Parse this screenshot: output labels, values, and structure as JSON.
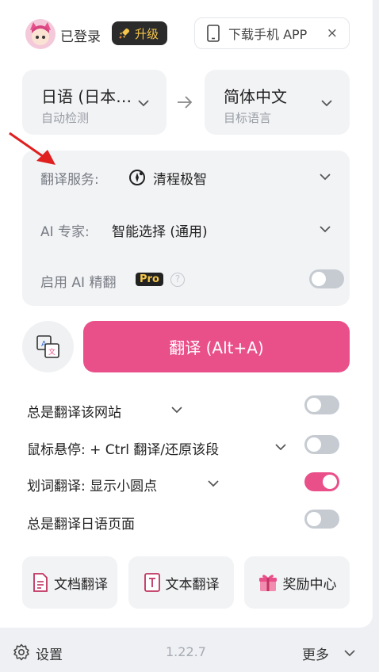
{
  "header": {
    "login_status": "已登录",
    "upgrade_label": "升级",
    "download_label": "下载手机 APP",
    "close_label": "×"
  },
  "languages": {
    "source": {
      "name": "日语 (日本…",
      "sub": "自动检测"
    },
    "target": {
      "name": "简体中文",
      "sub": "目标语言"
    }
  },
  "settings": {
    "service_label": "翻译服务:",
    "service_value": "清程极智",
    "expert_label": "AI 专家:",
    "expert_value": "智能选择 (通用)",
    "refine_label": "启用 AI 精翻",
    "pro_badge": "Pro",
    "help": "?",
    "refine_enabled": false
  },
  "translate_button": "翻译 (Alt+A)",
  "options": [
    {
      "label": "总是翻译该网站",
      "enabled": false
    },
    {
      "label": "鼠标悬停:  + Ctrl 翻译/还原该段",
      "enabled": false
    },
    {
      "label": "划词翻译:  显示小圆点",
      "enabled": true
    },
    {
      "label": "总是翻译日语页面",
      "enabled": false
    }
  ],
  "tools": {
    "doc_translate": "文档翻译",
    "text_translate": "文本翻译",
    "rewards": "奖励中心"
  },
  "footer": {
    "settings_label": "设置",
    "version": "1.22.7",
    "more_label": "更多"
  },
  "colors": {
    "accent": "#e9508a",
    "card_bg": "#f2f3f5",
    "toggle_off": "#c6cbd2",
    "annotation_arrow": "#e01f1f"
  },
  "icons": [
    "avatar",
    "rocket-icon",
    "tablet-icon",
    "close-icon",
    "chevron-down-icon",
    "arrow-right-icon",
    "service-logo-icon",
    "help-icon",
    "translate-swap-icon",
    "document-icon",
    "text-icon",
    "gift-icon",
    "gear-icon"
  ]
}
